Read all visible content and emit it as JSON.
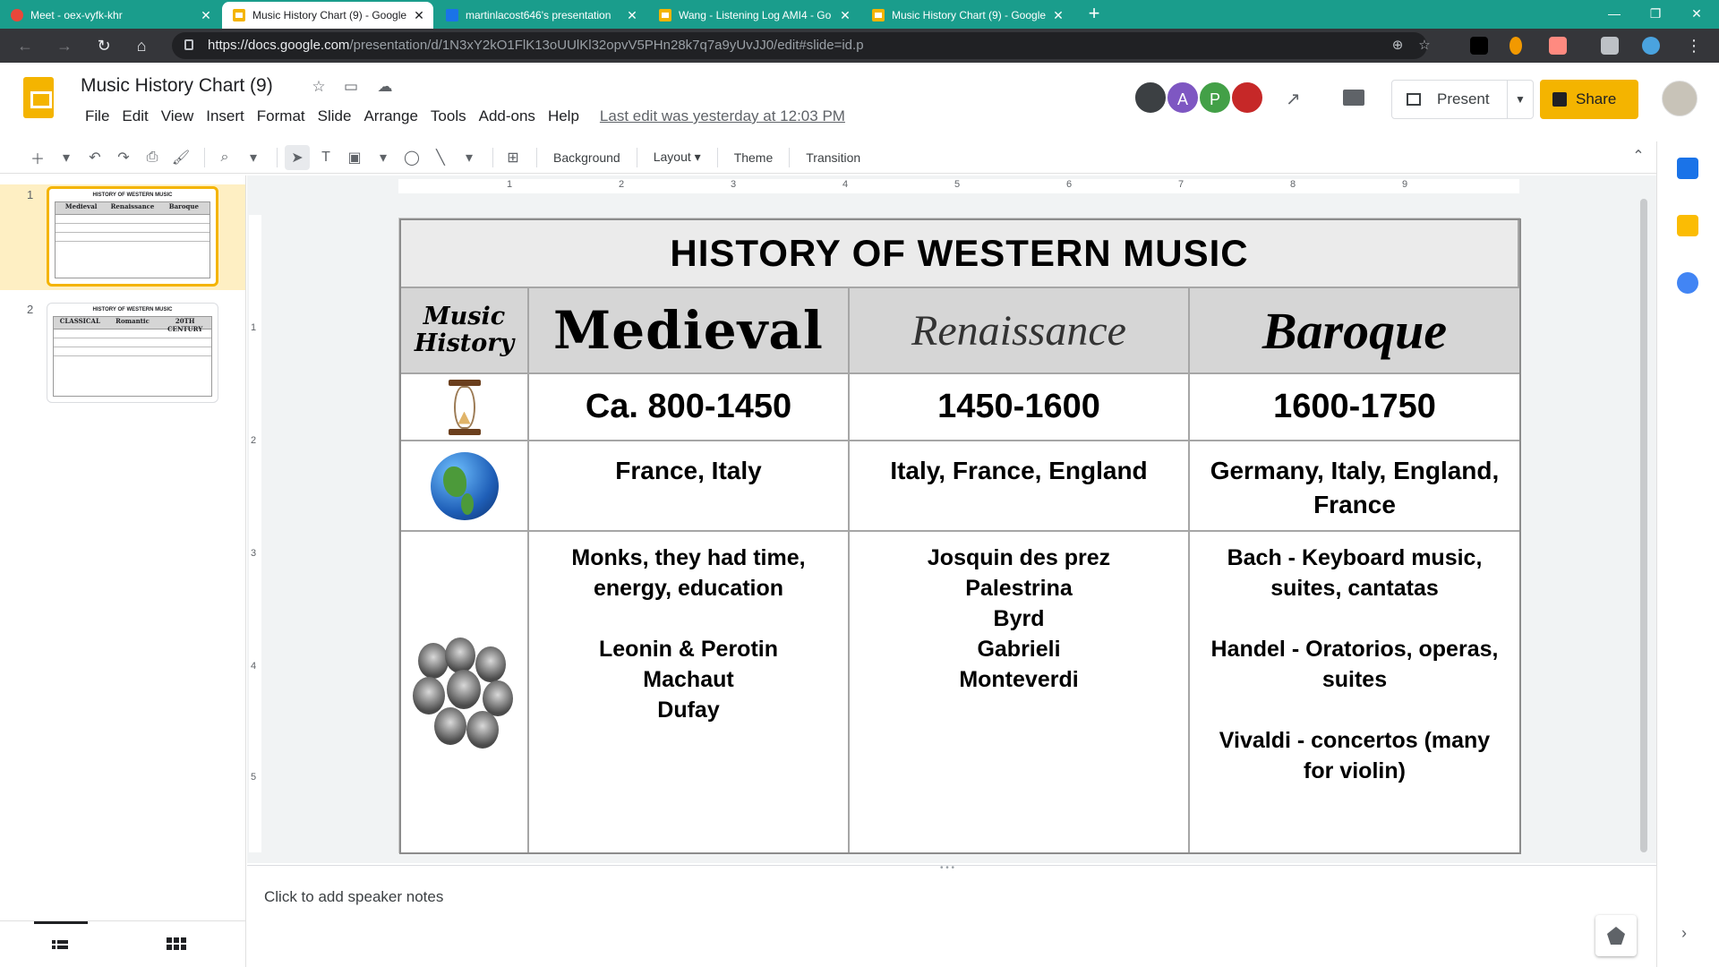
{
  "browser": {
    "tabs": [
      {
        "title": "Meet - oex-vyfk-khr",
        "active": false,
        "icon": "meet-icon"
      },
      {
        "title": "Music History Chart (9) - Google",
        "active": true,
        "icon": "slides-icon"
      },
      {
        "title": "martinlacost646's presentation",
        "active": false,
        "icon": "chart-icon"
      },
      {
        "title": "Wang - Listening Log AMI4 - Go",
        "active": false,
        "icon": "slides-icon"
      },
      {
        "title": "Music History Chart (9) - Google",
        "active": false,
        "icon": "slides-icon"
      }
    ],
    "url_host": "https://docs.google.com",
    "url_path": "/presentation/d/1N3xY2kO1FlK13oUUlKl32opvV5PHn28k7q7a9yUvJJ0/edit#slide=id.p",
    "accent_color": "#1a9d8c"
  },
  "app": {
    "doc_title": "Music History Chart (9)",
    "menu": [
      "File",
      "Edit",
      "View",
      "Insert",
      "Format",
      "Slide",
      "Arrange",
      "Tools",
      "Add-ons",
      "Help"
    ],
    "last_edit": "Last edit was yesterday at 12:03 PM",
    "collaborators": [
      {
        "initial": "",
        "color": "#3c4043"
      },
      {
        "initial": "A",
        "color": "#7e57c2"
      },
      {
        "initial": "P",
        "color": "#43a047"
      },
      {
        "initial": "",
        "color": "#c62828"
      }
    ],
    "present_label": "Present",
    "share_label": "Share",
    "share_color": "#f4b400"
  },
  "toolbar": {
    "background_label": "Background",
    "layout_label": "Layout",
    "theme_label": "Theme",
    "transition_label": "Transition"
  },
  "ruler": {
    "horizontal": [
      "1",
      "2",
      "3",
      "4",
      "5",
      "6",
      "7",
      "8",
      "9"
    ],
    "vertical": [
      "1",
      "2",
      "3",
      "4",
      "5"
    ]
  },
  "filmstrip": {
    "slides": [
      {
        "number": "1",
        "title": "HISTORY OF WESTERN MUSIC",
        "headers": [
          "Medieval",
          "Renaissance",
          "Baroque"
        ]
      },
      {
        "number": "2",
        "title": "HISTORY OF WESTERN MUSIC",
        "headers": [
          "CLASSICAL",
          "Romantic",
          "20TH CENTURY"
        ]
      }
    ]
  },
  "slide": {
    "title": "HISTORY OF WESTERN MUSIC",
    "row_label": "Music History",
    "periods": [
      {
        "name": "Medieval",
        "dates": "Ca. 800-1450",
        "places": "France, Italy",
        "people": "Monks, they had time, energy, education\n\nLeonin & Perotin\nMachaut\nDufay"
      },
      {
        "name": "Renaissance",
        "dates": "1450-1600",
        "places": "Italy, France, England",
        "people": "Josquin des prez\nPalestrina\nByrd\nGabrieli\nMonteverdi"
      },
      {
        "name": "Baroque",
        "dates": "1600-1750",
        "places": "Germany, Italy, England, France",
        "people": "Bach - Keyboard music, suites, cantatas\n\nHandel - Oratorios, operas, suites\n\nVivaldi - concertos (many for violin)"
      }
    ]
  },
  "notes": {
    "placeholder": "Click to add speaker notes"
  }
}
